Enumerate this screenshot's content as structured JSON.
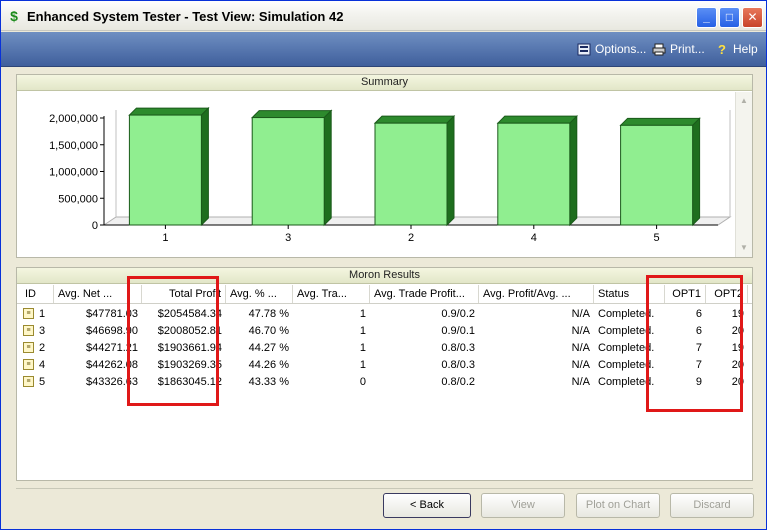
{
  "window": {
    "title": "Enhanced System Tester - Test View: Simulation 42",
    "app_icon": "$",
    "minimize_glyph": "_",
    "maximize_glyph": "□",
    "close_glyph": "✕"
  },
  "toolbar": {
    "options_label": "Options...",
    "print_label": "Print...",
    "help_label": "Help"
  },
  "summary": {
    "header": "Summary"
  },
  "chart_data": {
    "type": "bar",
    "categories": [
      "1",
      "3",
      "2",
      "4",
      "5"
    ],
    "values": [
      2054584.34,
      2008052.81,
      1903661.94,
      1903269.35,
      1863045.12
    ],
    "ylim": [
      0,
      2000000
    ],
    "yticks": [
      0,
      500000,
      1000000,
      1500000,
      2000000
    ],
    "ytick_labels": [
      "0",
      "500,000",
      "1,000,000",
      "1,500,000",
      "2,000,000"
    ],
    "bar_color": "#90ee90",
    "grid": false
  },
  "results": {
    "header": "Moron Results",
    "columns": [
      "ID",
      "Avg. Net ...",
      "Total Profit",
      "Avg. % ...",
      "Avg. Tra...",
      "Avg. Trade Profit...",
      "Avg. Profit/Avg. ...",
      "Status",
      "OPT1",
      "OPT2"
    ],
    "rows": [
      [
        "1",
        "$47781.03",
        "$2054584.34",
        "47.78 %",
        "1",
        "0.9/0.2",
        "N/A",
        "Completed.",
        "6",
        "19"
      ],
      [
        "3",
        "$46698.90",
        "$2008052.81",
        "46.70 %",
        "1",
        "0.9/0.1",
        "N/A",
        "Completed.",
        "6",
        "20"
      ],
      [
        "2",
        "$44271.21",
        "$1903661.94",
        "44.27 %",
        "1",
        "0.8/0.3",
        "N/A",
        "Completed.",
        "7",
        "19"
      ],
      [
        "4",
        "$44262.08",
        "$1903269.35",
        "44.26 %",
        "1",
        "0.8/0.3",
        "N/A",
        "Completed.",
        "7",
        "20"
      ],
      [
        "5",
        "$43326.63",
        "$1863045.12",
        "43.33 %",
        "0",
        "0.8/0.2",
        "N/A",
        "Completed.",
        "9",
        "20"
      ]
    ]
  },
  "buttons": {
    "back": "< Back",
    "view": "View",
    "plot": "Plot on Chart",
    "discard": "Discard"
  },
  "colors": {
    "highlight": "#e01818",
    "toolbar": "#4f6fac"
  }
}
